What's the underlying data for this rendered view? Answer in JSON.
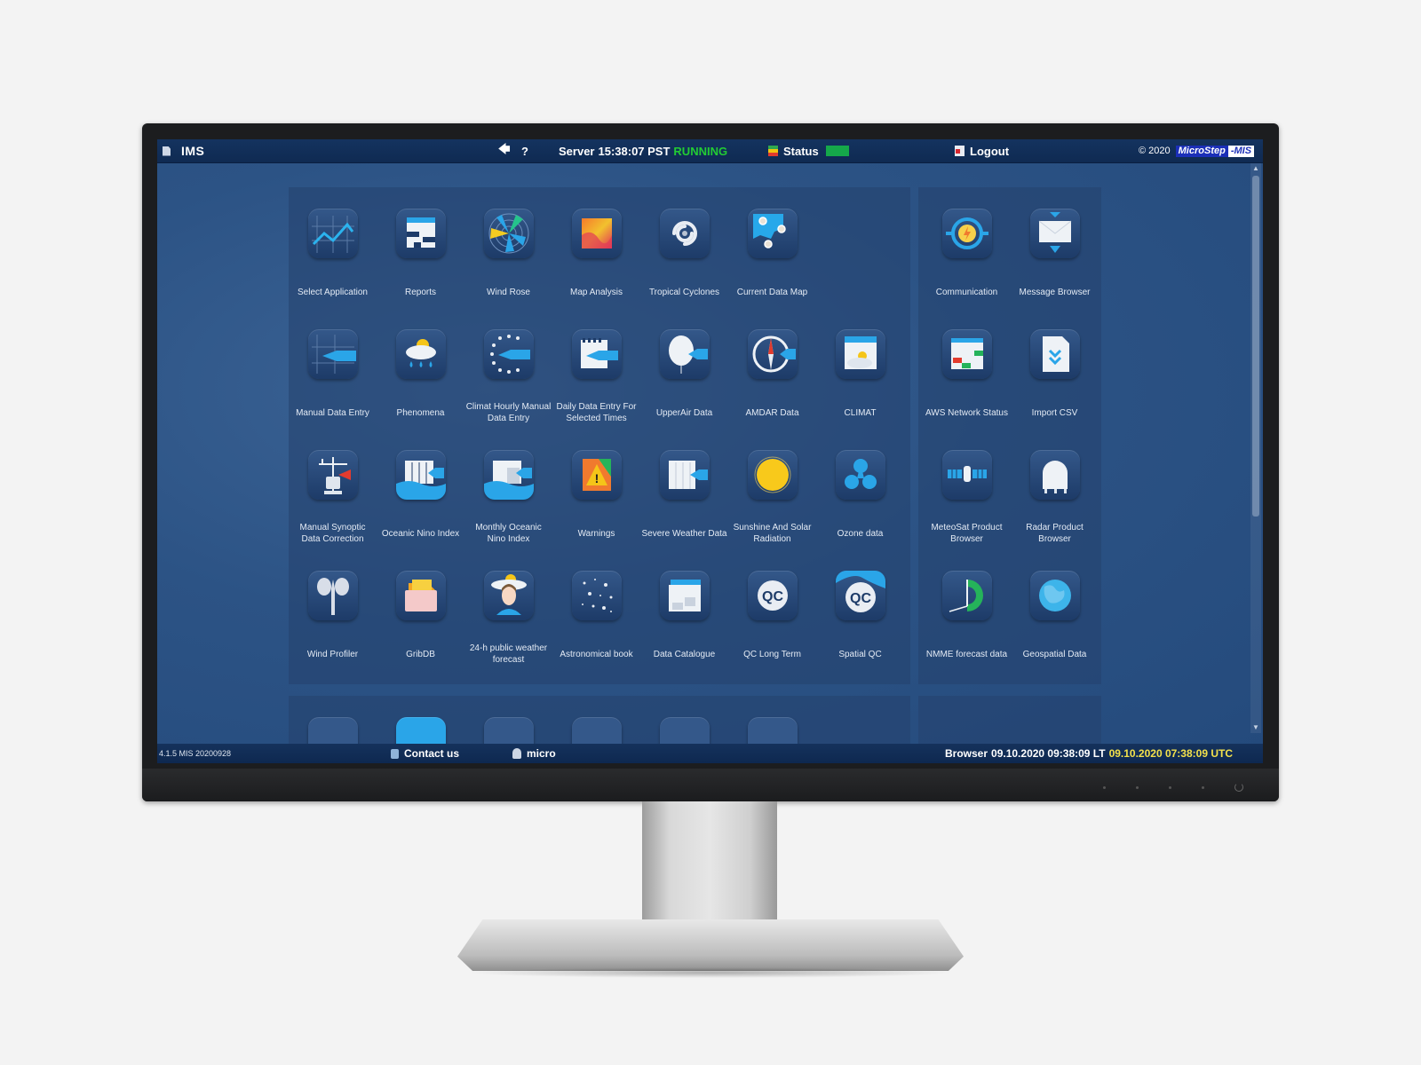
{
  "topbar": {
    "app_title": "IMS",
    "back_icon": "back-arrow-icon",
    "help_label": "?",
    "server_label": "Server",
    "server_time": "15:38:07 PST",
    "server_state": "RUNNING",
    "status_label": "Status",
    "logout_label": "Logout",
    "copyright": "© 2020",
    "logo_part1": "MicroStep",
    "logo_part2": "-MIS"
  },
  "main_apps": [
    {
      "label": "Select Application",
      "icon": "chart-line-icon"
    },
    {
      "label": "Reports",
      "icon": "reports-icon"
    },
    {
      "label": "Wind Rose",
      "icon": "wind-rose-icon"
    },
    {
      "label": "Map Analysis",
      "icon": "map-analysis-icon"
    },
    {
      "label": "Tropical Cyclones",
      "icon": "cyclone-icon"
    },
    {
      "label": "Current Data Map",
      "icon": "data-map-icon"
    },
    {
      "label": "",
      "icon": ""
    },
    {
      "label": "Manual Data Entry",
      "icon": "manual-entry-icon"
    },
    {
      "label": "Phenomena",
      "icon": "phenomena-icon"
    },
    {
      "label": "Climat Hourly Manual Data Entry",
      "icon": "climat-hourly-icon"
    },
    {
      "label": "Daily Data Entry For Selected Times",
      "icon": "daily-entry-icon"
    },
    {
      "label": "UpperAir Data",
      "icon": "balloon-icon"
    },
    {
      "label": "AMDAR Data",
      "icon": "compass-icon"
    },
    {
      "label": "CLIMAT",
      "icon": "climat-icon"
    },
    {
      "label": "Manual Synoptic Data Correction",
      "icon": "synoptic-station-icon"
    },
    {
      "label": "Oceanic Nino Index",
      "icon": "oceanic-nino-icon"
    },
    {
      "label": "Monthly Oceanic Nino Index",
      "icon": "monthly-nino-icon"
    },
    {
      "label": "Warnings",
      "icon": "warning-icon"
    },
    {
      "label": "Severe Weather Data",
      "icon": "severe-weather-icon"
    },
    {
      "label": "Sunshine And Solar Radiation",
      "icon": "sun-icon"
    },
    {
      "label": "Ozone data",
      "icon": "ozone-icon"
    },
    {
      "label": "Wind Profiler",
      "icon": "anemometer-icon"
    },
    {
      "label": "GribDB",
      "icon": "folder-icon"
    },
    {
      "label": "24-h public weather forecast",
      "icon": "forecaster-icon"
    },
    {
      "label": "Astronomical book",
      "icon": "stars-icon"
    },
    {
      "label": "Data Catalogue",
      "icon": "catalogue-icon"
    },
    {
      "label": "QC Long Term",
      "icon": "qc-icon"
    },
    {
      "label": "Spatial QC",
      "icon": "spatial-qc-icon"
    }
  ],
  "side_apps": [
    {
      "label": "Communication",
      "icon": "communication-icon"
    },
    {
      "label": "Message Browser",
      "icon": "envelope-icon"
    },
    {
      "label": "AWS Network Status",
      "icon": "aws-status-icon"
    },
    {
      "label": "Import CSV",
      "icon": "import-csv-icon"
    },
    {
      "label": "MeteoSat Product Browser",
      "icon": "satellite-icon"
    },
    {
      "label": "Radar Product Browser",
      "icon": "radar-icon"
    },
    {
      "label": "NMME forecast data",
      "icon": "nmme-clock-icon"
    },
    {
      "label": "Geospatial Data",
      "icon": "globe-icon"
    }
  ],
  "statusbar": {
    "version": "4.1.5 MIS 20200928",
    "contact_label": "Contact us",
    "user": "micro",
    "browser_label": "Browser",
    "local_time": "09.10.2020 09:38:09 LT",
    "utc_time": "09.10.2020 07:38:09 UTC"
  }
}
